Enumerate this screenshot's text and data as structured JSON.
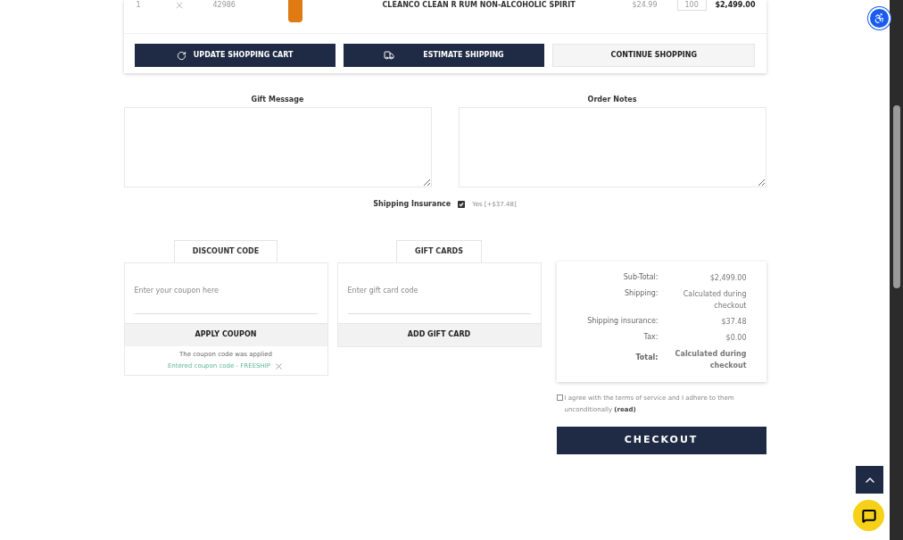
{
  "cart_row": {
    "line": "1",
    "sku": "42986",
    "product": "CLEANCO CLEAN R RUM NON-ALCOHOLIC SPIRIT",
    "price": "$24.99",
    "quantity": "100",
    "total": "$2,499.00"
  },
  "cart_buttons": [
    {
      "label": "UPDATE SHOPPING CART",
      "kind": "update"
    },
    {
      "label": "ESTIMATE SHIPPING",
      "kind": "shipping"
    },
    {
      "label": "CONTINUE SHOPPING",
      "kind": "plain"
    }
  ],
  "gift_message": {
    "label": "Gift Message"
  },
  "order_notes": {
    "label": "Order Notes"
  },
  "shipping_insurance": {
    "label": "Shipping Insurance",
    "checked": true,
    "option": "Yes [+$37.48]"
  },
  "discount": {
    "tab": "DISCOUNT CODE",
    "placeholder": "Enter your coupon here",
    "button": "APPLY COUPON",
    "message": "The coupon code was applied",
    "applied": "Entered coupon code - FREESHIP"
  },
  "gift_cards": {
    "tab": "GIFT CARDS",
    "placeholder": "Enter gift card code",
    "button": "ADD GIFT CARD"
  },
  "summary": [
    {
      "label": "Sub-Total:",
      "value": "$2,499.00",
      "bold": false
    },
    {
      "label": "Shipping:",
      "value": "Calculated during checkout",
      "bold": false
    },
    {
      "label": "Shipping insurance:",
      "value": "$37.48",
      "bold": false
    },
    {
      "label": "Tax:",
      "value": "$0.00",
      "bold": false
    },
    {
      "label": "Total:",
      "value": "Calculated during checkout",
      "bold": true
    }
  ],
  "terms": {
    "checked": false,
    "text": "I agree with the terms of service and I adhere to them unconditionally",
    "link": "(read)"
  },
  "checkout": "CHECKOUT"
}
